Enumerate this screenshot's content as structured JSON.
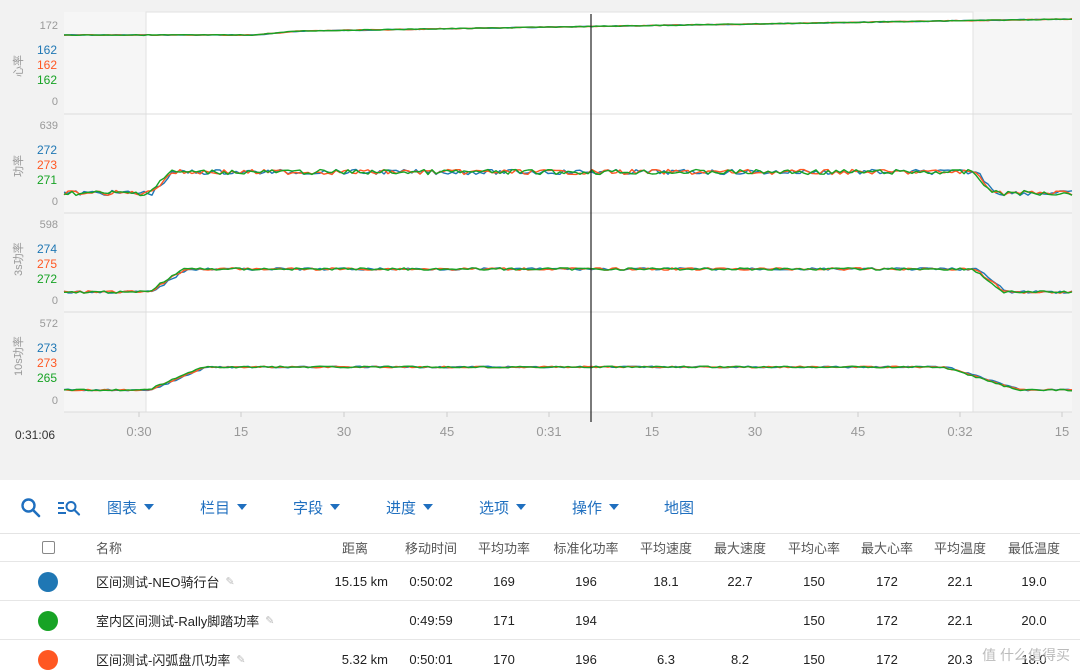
{
  "colors": {
    "series_blue": "#1f77b4",
    "series_orange": "#ff5722",
    "series_green": "#17a325",
    "accent": "#1f6fbf"
  },
  "chart": {
    "cursor_time": "0:31:06",
    "x_ticks": [
      "0:30",
      "15",
      "30",
      "45",
      "0:31",
      "15",
      "30",
      "45",
      "0:32",
      "15"
    ],
    "panes": [
      {
        "axis_title": "心率",
        "max": "172",
        "zero": "0",
        "values": [
          "162",
          "162",
          "162"
        ]
      },
      {
        "axis_title": "功率",
        "max": "639",
        "zero": "0",
        "values": [
          "272",
          "273",
          "271"
        ]
      },
      {
        "axis_title": "3s功率",
        "max": "598",
        "zero": "0",
        "values": [
          "274",
          "275",
          "272"
        ]
      },
      {
        "axis_title": "10s功率",
        "max": "572",
        "zero": "0",
        "values": [
          "273",
          "273",
          "265"
        ]
      }
    ]
  },
  "toolbar": {
    "search_icon": "search-icon",
    "zoom_icon": "zoom-list-icon",
    "menus": [
      "图表",
      "栏目",
      "字段",
      "进度",
      "选项",
      "操作"
    ],
    "map_label": "地图"
  },
  "table": {
    "headers": [
      "名称",
      "距离",
      "移动时间",
      "平均功率",
      "标准化功率",
      "平均速度",
      "最大速度",
      "平均心率",
      "最大心率",
      "平均温度",
      "最低温度"
    ],
    "rows": [
      {
        "color": "#1f77b4",
        "name": "区间测试-NEO骑行台",
        "distance": "15.15 km",
        "moving_time": "0:50:02",
        "avg_power": "169",
        "np": "196",
        "avg_speed": "18.1",
        "max_speed": "22.7",
        "avg_hr": "150",
        "max_hr": "172",
        "avg_temp": "22.1",
        "min_temp": "19.0"
      },
      {
        "color": "#17a325",
        "name": "室内区间测试-Rally脚踏功率",
        "distance": "",
        "moving_time": "0:49:59",
        "avg_power": "171",
        "np": "194",
        "avg_speed": "",
        "max_speed": "",
        "avg_hr": "150",
        "max_hr": "172",
        "avg_temp": "22.1",
        "min_temp": "20.0"
      },
      {
        "color": "#ff5722",
        "name": "区间测试-闪弧盘爪功率",
        "distance": "5.32 km",
        "moving_time": "0:50:01",
        "avg_power": "170",
        "np": "196",
        "avg_speed": "6.3",
        "max_speed": "8.2",
        "avg_hr": "150",
        "max_hr": "172",
        "avg_temp": "20.3",
        "min_temp": "18.0"
      }
    ]
  },
  "watermark": "值 什么值得买"
}
